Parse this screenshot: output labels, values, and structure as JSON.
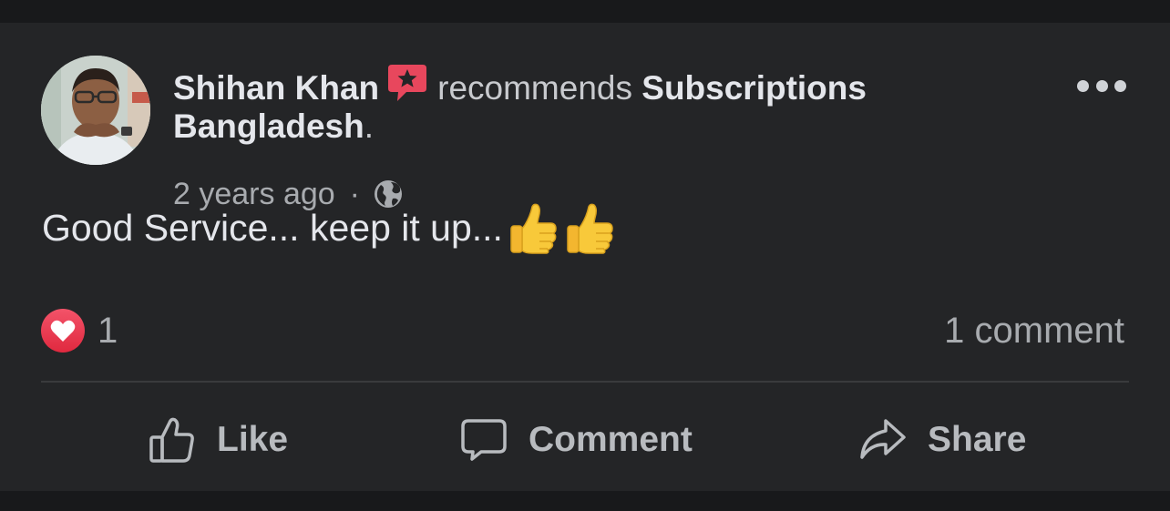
{
  "post": {
    "author": "Shihan Khan",
    "verb": "recommends",
    "page_name_1": "Subscriptions",
    "page_name_2": "Bangladesh",
    "period": ".",
    "timestamp": "2 years ago",
    "separator": "·",
    "privacy_icon": "globe-icon",
    "badge_icon": "recommendation-star-icon",
    "body": "Good Service... keep it up...",
    "body_emojis": [
      "thumbs-up-emoji",
      "thumbs-up-emoji"
    ]
  },
  "engagement": {
    "reaction_icon": "love-reaction-icon",
    "reaction_count": "1",
    "comments": "1 comment"
  },
  "actions": {
    "like": "Like",
    "comment": "Comment",
    "share": "Share"
  },
  "colors": {
    "background": "#18191b",
    "card": "#242527",
    "primary_text": "#e4e6eb",
    "secondary_text": "#a8abaf",
    "badge": "#e8475d",
    "love": "#f35369",
    "emoji_yellow": "#f8c93a"
  }
}
